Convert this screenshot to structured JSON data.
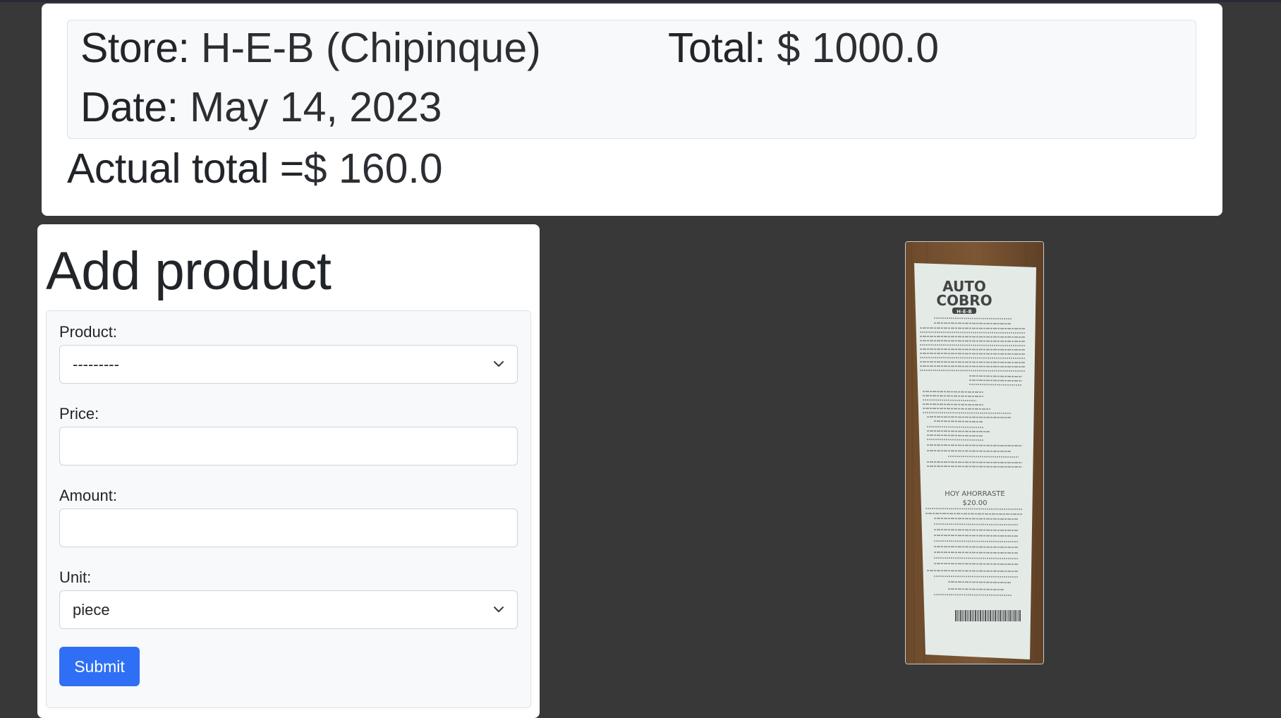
{
  "summary": {
    "store_label": "Store:",
    "store_value": "H-E-B (Chipinque)",
    "total_label": "Total:",
    "total_value": "$ 1000.0",
    "date_label": "Date:",
    "date_value": "May 14, 2023",
    "actual_total_label": "Actual total =",
    "actual_total_value": "$ 160.0"
  },
  "form": {
    "title": "Add product",
    "product_label": "Product:",
    "product_selected": "---------",
    "price_label": "Price:",
    "price_value": "",
    "amount_label": "Amount:",
    "amount_value": "",
    "unit_label": "Unit:",
    "unit_selected": "piece",
    "submit_label": "Submit"
  },
  "receipt": {
    "header_line1": "AUTO",
    "header_line2": "COBRO",
    "header_brand": "H-E-B",
    "saved_line": "HOY AHORRASTE",
    "saved_amount": "$20.00"
  },
  "icons": {
    "select_arrow": "chevron-down-icon"
  }
}
